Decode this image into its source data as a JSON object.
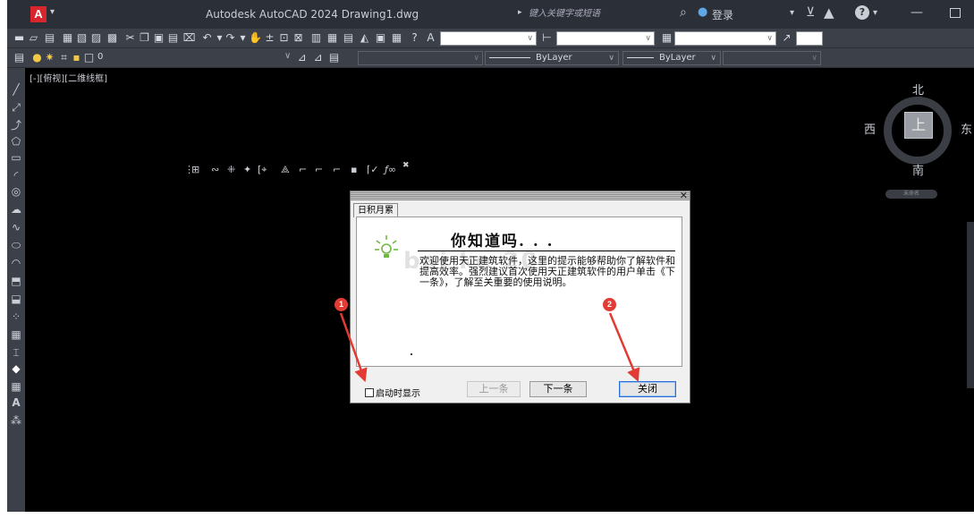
{
  "app": {
    "logo_letter": "A",
    "title": "Autodesk AutoCAD 2024    Drawing1.dwg",
    "search_placeholder": "键入关键字或短语",
    "login_label": "登录"
  },
  "toolbar": {
    "text_style_combo": "",
    "color_bylayer": "ByLayer",
    "linetype_bylayer": "ByLayer",
    "layer_value": "0"
  },
  "canvas": {
    "view_label": "[-][俯视][二维线框]"
  },
  "viewcube": {
    "north": "北",
    "south": "南",
    "west": "西",
    "east": "东",
    "face": "上",
    "wcs": "未命名"
  },
  "dialog": {
    "tab_label": "日积月累",
    "headline": "你知道吗. . .",
    "tip_text": "欢迎使用天正建筑软件，这里的提示能够帮助你了解软件和提高效率。强烈建议首次使用天正建筑软件的用户单击《下一条》，了解至关重要的使用说明。",
    "watermark": "bai   ke    20",
    "checkbox_label": "启动时显示",
    "prev_label": "上一条",
    "next_label": "下一条",
    "close_label": "关闭"
  },
  "annotations": {
    "badge1": "1",
    "badge2": "2",
    "color": "#e23b33"
  }
}
